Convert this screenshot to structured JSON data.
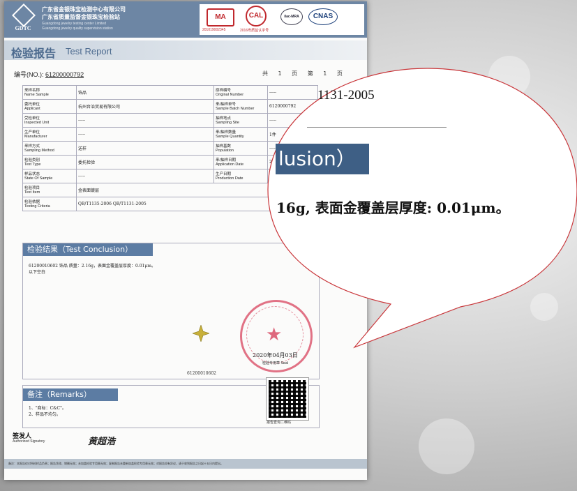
{
  "header": {
    "logo_text": "GDTC",
    "company_cn_1": "广东省金银珠宝检测中心有限公司",
    "company_cn_2": "广东省质量监督金银珠宝检验站",
    "company_en_1": "Guangdong jewelry testing center Limited",
    "company_en_2": "Guangdong jewelry quality supervision station",
    "cert_1": "MA",
    "cert_2": "CAL",
    "cert_3": "ilac-MRA",
    "cert_4": "CNAS",
    "cert_1_code": "201019002345",
    "cert_2_code": "2016粤质监认字号"
  },
  "report": {
    "title_cn": "检验报告",
    "title_en": "Test Report",
    "number_label": "编号(NO.):",
    "number_value": "61200000792",
    "page_info": "共 1 页 第 1 页"
  },
  "fields_left": [
    {
      "label_cn": "来样名称",
      "label_en": "Name Sample",
      "value": "饰品"
    },
    {
      "label_cn": "委托单位",
      "label_en": "Applicant",
      "value": "杭州台治贸易有限公司"
    },
    {
      "label_cn": "受检单位",
      "label_en": "Inspected Unit",
      "value": "-----"
    },
    {
      "label_cn": "生产单位",
      "label_en": "Manufacturer",
      "value": "-----"
    },
    {
      "label_cn": "来样方式",
      "label_en": "Sampling Method",
      "value": "送样"
    },
    {
      "label_cn": "检验类别",
      "label_en": "Test Type",
      "value": "委托检验"
    },
    {
      "label_cn": "样品状态",
      "label_en": "State Of Sample",
      "value": "-----"
    },
    {
      "label_cn": "检验项目",
      "label_en": "Test Item",
      "value": "金表面镀层"
    },
    {
      "label_cn": "检验依据",
      "label_en": "Testing Criteria",
      "value": "QB/T1135-2006 QB/T1131-2005"
    }
  ],
  "fields_right": [
    {
      "label_cn": "原样编号",
      "label_en": "Original Number",
      "value": "-----"
    },
    {
      "label_cn": "来/抽样单号",
      "label_en": "Sample Batch Number",
      "value": "6120000792"
    },
    {
      "label_cn": "抽样地点",
      "label_en": "Sampling Site",
      "value": "-----"
    },
    {
      "label_cn": "来/抽样数量",
      "label_en": "Sample Quantity",
      "value": "1件"
    },
    {
      "label_cn": "抽样基数",
      "label_en": "Population",
      "value": "-----"
    },
    {
      "label_cn": "来/抽样日期",
      "label_en": "Application Date",
      "value": "2020"
    },
    {
      "label_cn": "生产日期",
      "label_en": "Production Date",
      "value": "-----"
    }
  ],
  "conclusion": {
    "heading": "检验结果（Test Conclusion）",
    "line_1": "61200010602  饰品  质量：2.16g，表面金覆盖层厚度：0.01μm。",
    "line_2": "以下空白"
  },
  "stamp": {
    "date": "2020年04月03日",
    "sub": "检验专用章 Seal"
  },
  "bottom_code": "61200010602",
  "remarks": {
    "heading": "备注（Remarks）",
    "line_1": "1、\"商标：C&C\"。",
    "line_2": "2、样品不均匀。"
  },
  "qr_label": "报告查询二维码",
  "signatory": {
    "label_cn": "签发人",
    "label_en": "Authorized Signatory",
    "name": "黄超浩"
  },
  "footer_text": "备注：本报告仅对所检样品负责；报告涂改、增删无效；未加盖检验专用章无效；复制报告未重新加盖检验专用章无效；对报告如有异议，请于收到报告之日起十五日内提出。",
  "callout": {
    "top_text": "1131-2005",
    "heading": "lusion）",
    "body": "16g, 表面金覆盖层厚度: 0.01μm。"
  }
}
